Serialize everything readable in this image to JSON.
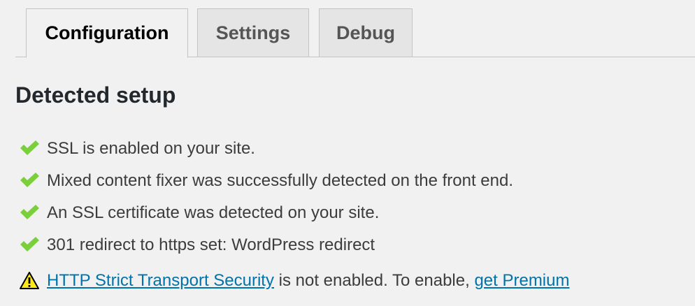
{
  "tabs": {
    "configuration": "Configuration",
    "settings": "Settings",
    "debug": "Debug"
  },
  "section": {
    "title": "Detected setup"
  },
  "status_items": [
    {
      "icon": "checkmark-icon",
      "text": "SSL is enabled on your site."
    },
    {
      "icon": "checkmark-icon",
      "text": "Mixed content fixer was successfully detected on the front end."
    },
    {
      "icon": "checkmark-icon",
      "text": "An SSL certificate was detected on your site."
    },
    {
      "icon": "checkmark-icon",
      "text": "301 redirect to https set: WordPress redirect"
    }
  ],
  "warning": {
    "icon": "warning-icon",
    "link_text": "HTTP Strict Transport Security",
    "middle_text": " is not enabled. To enable, ",
    "premium_link_text": "get Premium"
  },
  "colors": {
    "check": "#7ad03a",
    "warning_fill": "#ffe81a",
    "link": "#0073aa",
    "background": "#f1f1f1",
    "inactive_tab": "#e5e5e5"
  }
}
